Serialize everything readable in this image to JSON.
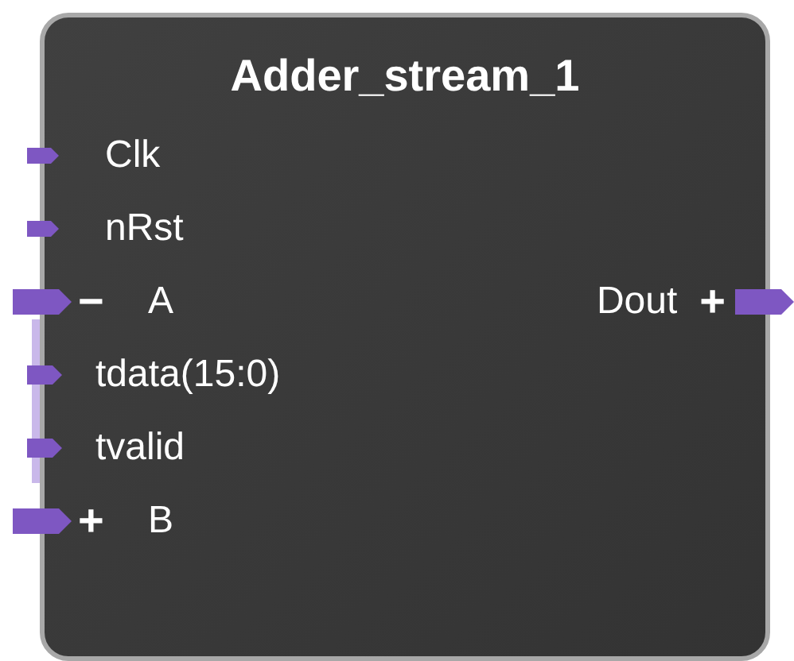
{
  "block": {
    "title": "Adder_stream_1",
    "inputs": [
      {
        "kind": "signal",
        "name": "Clk"
      },
      {
        "kind": "signal",
        "name": "nRst"
      },
      {
        "kind": "bus",
        "sign": "−",
        "name": "A",
        "children": [
          {
            "kind": "signal",
            "name": "tdata(15:0)"
          },
          {
            "kind": "signal",
            "name": "tvalid"
          }
        ]
      },
      {
        "kind": "bus",
        "sign": "+",
        "name": "B"
      }
    ],
    "outputs": [
      {
        "kind": "bus",
        "sign": "+",
        "name": "Dout"
      }
    ]
  }
}
